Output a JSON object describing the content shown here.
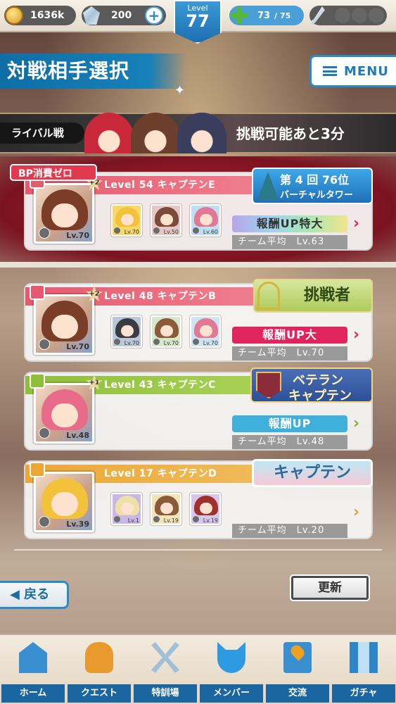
{
  "top": {
    "coins": "1636k",
    "gems": "200",
    "level_label": "Level",
    "level": "77",
    "stamina": "73",
    "stamina_max": "/ 75"
  },
  "header": {
    "title": "対戦相手選択",
    "menu_label": "MENU"
  },
  "rival": {
    "label": "ライバル戦",
    "remaining": "挑戦可能あと3分"
  },
  "bp_label": "BP消費ゼロ",
  "cards": [
    {
      "strip": "Level 54 キャプテンE",
      "strip_color": "#e45a6e",
      "leader_lv": "Lv.70",
      "plus": "+2",
      "members": [
        {
          "lv": "Lv.70"
        },
        {
          "lv": "Lv.50"
        },
        {
          "lv": "Lv.60"
        }
      ],
      "reward": "報酬UP特大",
      "avg": "チーム平均　Lv.63",
      "badge_line1": "第 4 回 76位",
      "badge_line2": "バーチャルタワー"
    },
    {
      "strip": "Level 48 キャプテンB",
      "strip_color": "#e45a6e",
      "leader_lv": "Lv.70",
      "plus": "+2",
      "members": [
        {
          "lv": "Lv.70"
        },
        {
          "lv": "Lv.70"
        },
        {
          "lv": "Lv.70"
        }
      ],
      "reward": "報酬UP大",
      "avg": "チーム平均　Lv.70",
      "badge": "挑戦者"
    },
    {
      "strip": "Level 43 キャプテンC",
      "strip_color": "#8fbf3a",
      "leader_lv": "Lv.48",
      "plus": "+1",
      "members": [],
      "reward": "報酬UP",
      "avg": "チーム平均　Lv.48",
      "badge_line1": "ベテラン",
      "badge_line2": "キャプテン"
    },
    {
      "strip": "Level 17 キャプテンD",
      "strip_color": "#eba736",
      "leader_lv": "Lv.39",
      "members": [
        {
          "lv": "Lv.1"
        },
        {
          "lv": "Lv.19"
        },
        {
          "lv": "Lv.19"
        }
      ],
      "avg": "チーム平均　Lv.20",
      "badge": "キャプテン"
    }
  ],
  "buttons": {
    "back": "◀ 戻る",
    "refresh": "更新"
  },
  "nav": [
    {
      "label": "ホーム",
      "icon": "school-icon"
    },
    {
      "label": "クエスト",
      "icon": "quest-monster-icon"
    },
    {
      "label": "特訓場",
      "icon": "crossed-swords-icon"
    },
    {
      "label": "メンバー",
      "icon": "member-cat-icon"
    },
    {
      "label": "交流",
      "icon": "map-pin-icon"
    },
    {
      "label": "ガチャ",
      "icon": "curtain-stage-icon"
    }
  ],
  "colors": {
    "accent_blue": "#1e7bb9",
    "reward_special": "#b7a6e8",
    "reward_big": "#e0245e",
    "reward_normal": "#3fb0d9"
  }
}
